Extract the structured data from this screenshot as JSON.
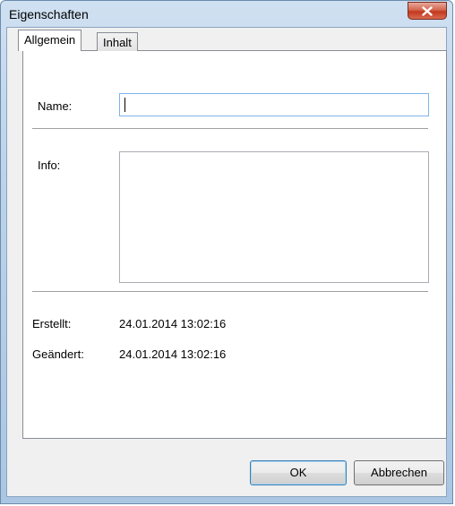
{
  "window": {
    "title": "Eigenschaften"
  },
  "tabs": [
    {
      "label": "Allgemein",
      "active": true
    },
    {
      "label": "Inhalt",
      "active": false
    }
  ],
  "form": {
    "name_label": "Name:",
    "name_value": "",
    "info_label": "Info:",
    "info_value": "",
    "created_label": "Erstellt:",
    "created_value": "24.01.2014 13:02:16",
    "modified_label": "Geändert:",
    "modified_value": "24.01.2014 13:02:16"
  },
  "buttons": {
    "ok": "OK",
    "cancel": "Abbrechen"
  },
  "icons": {
    "close": "close-icon"
  }
}
